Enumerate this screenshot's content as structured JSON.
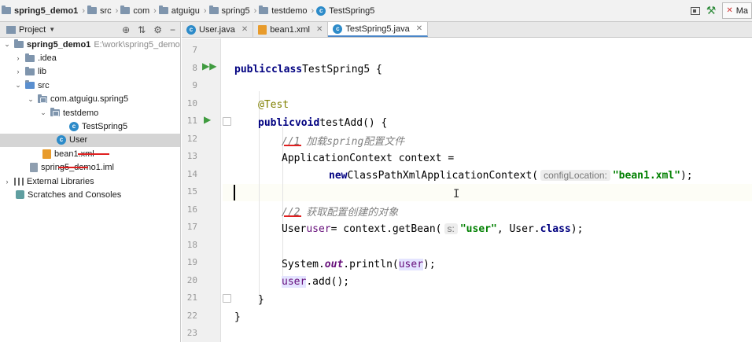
{
  "breadcrumb": [
    "spring5_demo1",
    "src",
    "com",
    "atguigu",
    "spring5",
    "testdemo",
    "TestSpring5"
  ],
  "toolbar": {
    "run_config_label": "Ma"
  },
  "project_panel": {
    "title": "Project",
    "tree": [
      {
        "label": "spring5_demo1",
        "path": "E:\\work\\spring5_demo",
        "icon": "module-folder-icon",
        "expanded": true
      },
      {
        "label": ".idea",
        "icon": "folder-icon",
        "expanded": false
      },
      {
        "label": "lib",
        "icon": "folder-icon",
        "expanded": false
      },
      {
        "label": "src",
        "icon": "source-folder-icon",
        "expanded": true
      },
      {
        "label": "com.atguigu.spring5",
        "icon": "package-icon",
        "expanded": true
      },
      {
        "label": "testdemo",
        "icon": "package-icon",
        "expanded": true
      },
      {
        "label": "TestSpring5",
        "icon": "class-icon"
      },
      {
        "label": "User",
        "icon": "class-icon",
        "selected": true
      },
      {
        "label": "bean1.xml",
        "icon": "xml-file-icon"
      },
      {
        "label": "spring5_demo1.iml",
        "icon": "iml-file-icon"
      },
      {
        "label": "External Libraries",
        "icon": "libraries-icon",
        "expanded": false
      },
      {
        "label": "Scratches and Consoles",
        "icon": "scratches-icon"
      }
    ]
  },
  "tabs": [
    {
      "label": "User.java",
      "icon": "class-icon",
      "active": false
    },
    {
      "label": "bean1.xml",
      "icon": "xml-file-icon",
      "active": false
    },
    {
      "label": "TestSpring5.java",
      "icon": "class-icon",
      "active": true
    }
  ],
  "editor": {
    "line_numbers": [
      "7",
      "8",
      "9",
      "10",
      "11",
      "12",
      "13",
      "14",
      "15",
      "16",
      "17",
      "18",
      "19",
      "20",
      "21",
      "22",
      "23"
    ],
    "code": {
      "l8_kw1": "public",
      "l8_kw2": "class",
      "l8_name": "TestSpring5 {",
      "l10_ann": "@Test",
      "l11_kw1": "public",
      "l11_kw2": "void",
      "l11_rest": "testAdd() {",
      "l12_comment": "//1 加载spring配置文件",
      "l13_text": "ApplicationContext context =",
      "l14_kw": "new",
      "l14_cls": "ClassPathXmlApplicationContext(",
      "l14_hint": "configLocation:",
      "l14_str": "\"bean1.xml\"",
      "l14_end": ");",
      "l16_comment": "//2 获取配置创建的对象",
      "l17_type": "User",
      "l17_var": "user",
      "l17_mid": "= context.getBean(",
      "l17_hint": "s:",
      "l17_str": "\"user\"",
      "l17_mid2": ", User.",
      "l17_kw": "class",
      "l17_end": ");",
      "l19_a": "System.",
      "l19_field": "out",
      "l19_b": ".println(",
      "l19_var": "user",
      "l19_end": ");",
      "l20_var": "user",
      "l20_rest": ".add();",
      "l21_text": "}",
      "l22_text": "}"
    }
  }
}
